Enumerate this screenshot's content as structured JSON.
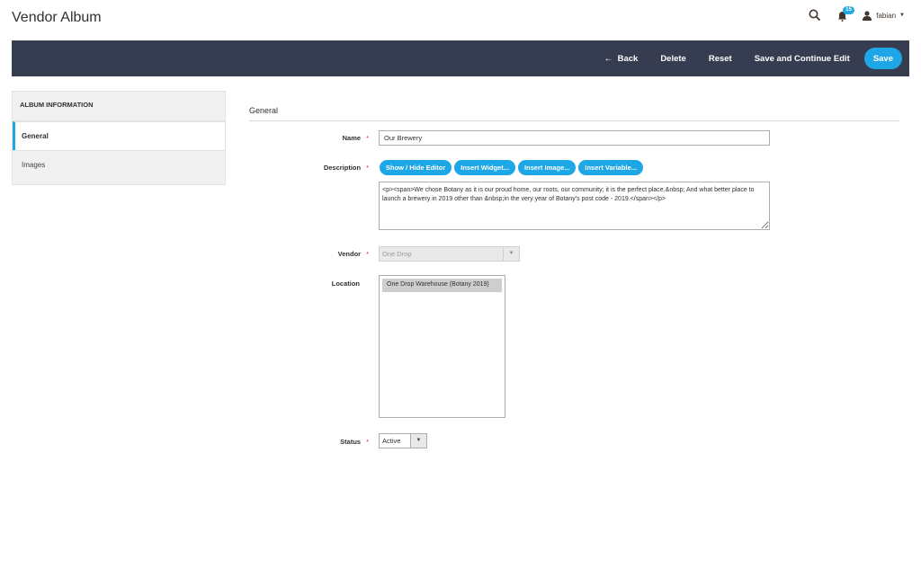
{
  "header": {
    "title": "Vendor Album",
    "notification_count": "15",
    "user_name": "fabian"
  },
  "toolbar": {
    "back_label": "Back",
    "delete_label": "Delete",
    "reset_label": "Reset",
    "save_continue_label": "Save and Continue Edit",
    "save_label": "Save"
  },
  "sidebar": {
    "title": "ALBUM INFORMATION",
    "items": [
      {
        "label": "General",
        "active": true
      },
      {
        "label": "Images",
        "active": false
      }
    ]
  },
  "form": {
    "section_title": "General",
    "name": {
      "label": "Name",
      "value": "Our Brewery"
    },
    "description": {
      "label": "Description",
      "buttons": [
        "Show / Hide Editor",
        "Insert Widget...",
        "Insert Image...",
        "Insert Variable..."
      ],
      "value": "<p><span>We chose Botany as it is our proud home, our roots, our community; it is the perfect place.&nbsp; And what better place to launch a brewery in 2019 other than &nbsp;in the very year of Botany's post code - 2019.</span></p>"
    },
    "vendor": {
      "label": "Vendor",
      "value": "One Drop"
    },
    "location": {
      "label": "Location",
      "options": [
        "One Drop Warehouse (Botany 2019)"
      ]
    },
    "status": {
      "label": "Status",
      "value": "Active"
    }
  },
  "colors": {
    "toolbar_bg": "#373d51",
    "accent": "#1ea7e6",
    "required": "#e22626"
  },
  "icons": [
    "search-icon",
    "bell-icon",
    "user-icon",
    "back-arrow-icon",
    "chevron-down-icon"
  ]
}
